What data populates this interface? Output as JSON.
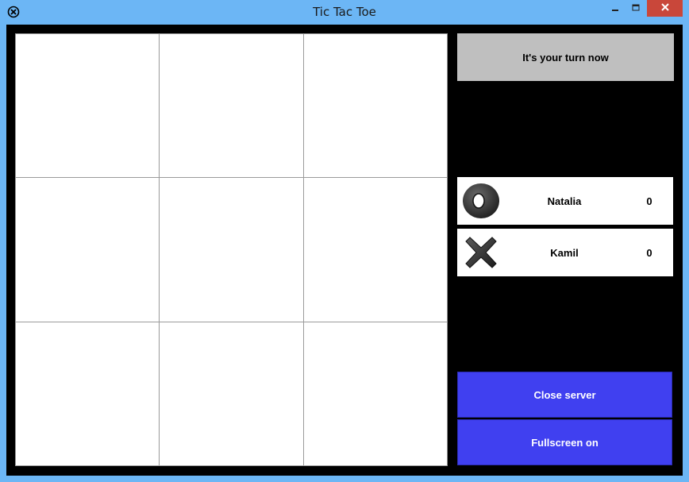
{
  "window": {
    "title": "Tic Tac Toe",
    "icons": {
      "app": "close-circle-icon",
      "minimize": "minimize-icon",
      "maximize": "maximize-icon",
      "close": "close-icon"
    }
  },
  "board": {
    "cells": [
      "",
      "",
      "",
      "",
      "",
      "",
      "",
      "",
      ""
    ]
  },
  "status": {
    "turn_text": "It's your turn now"
  },
  "players": [
    {
      "name": "Natalia",
      "score": "0",
      "symbol": "o-piece-icon"
    },
    {
      "name": "Kamil",
      "score": "0",
      "symbol": "x-piece-icon"
    }
  ],
  "actions": {
    "close_server_label": "Close server",
    "fullscreen_label": "Fullscreen on"
  },
  "colors": {
    "titlebar": "#6cb6f5",
    "close_button": "#c9473a",
    "background": "#000000",
    "turn_banner": "#bfbfbf",
    "action_button": "#4040f0"
  }
}
